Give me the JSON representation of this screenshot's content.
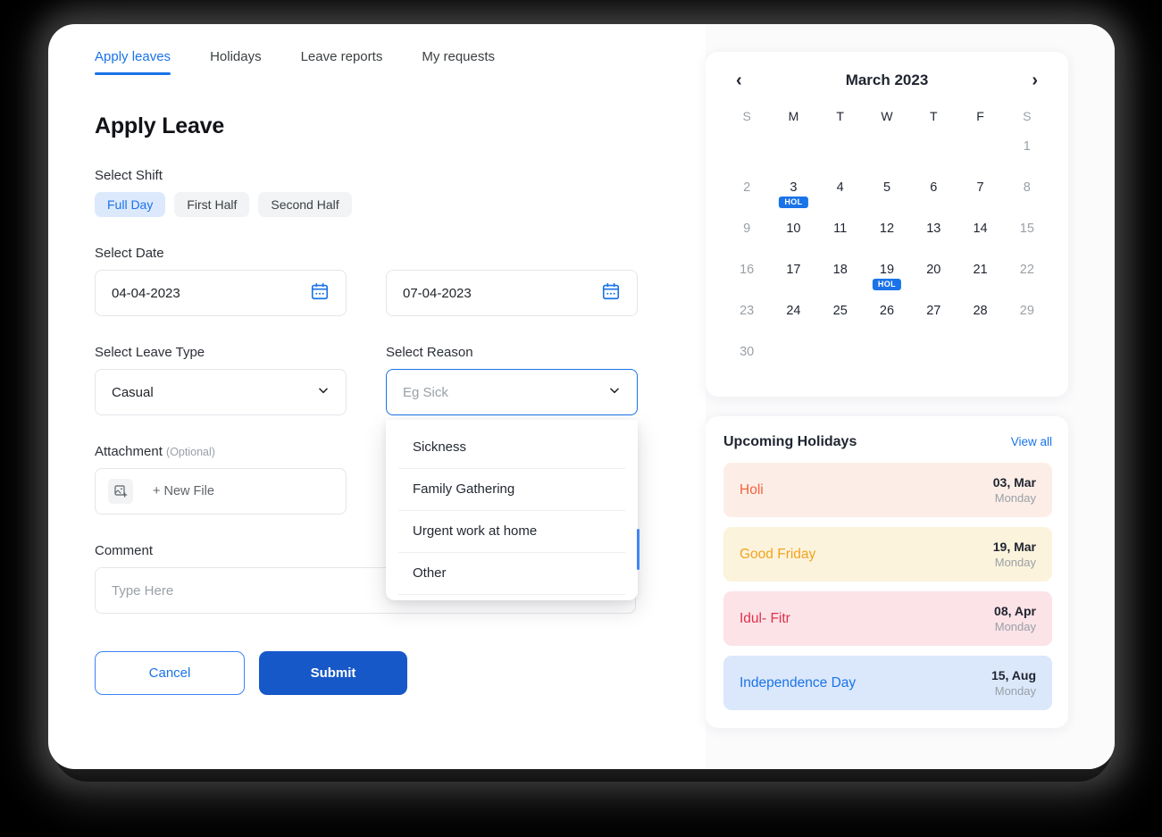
{
  "tabs": [
    {
      "label": "Apply leaves",
      "active": true
    },
    {
      "label": "Holidays",
      "active": false
    },
    {
      "label": "Leave reports",
      "active": false
    },
    {
      "label": "My requests",
      "active": false
    }
  ],
  "page_title": "Apply Leave",
  "shift": {
    "label": "Select Shift",
    "options": [
      "Full Day",
      "First Half",
      "Second Half"
    ],
    "selected": "Full Day"
  },
  "date": {
    "label": "Select Date",
    "from": "04-04-2023",
    "to": "07-04-2023",
    "icon": "calendar-icon"
  },
  "leave_type": {
    "label": "Select Leave Type",
    "value": "Casual",
    "icon": "chevron-down-icon"
  },
  "reason": {
    "label": "Select Reason",
    "placeholder": "Eg Sick",
    "value": "",
    "icon": "chevron-down-icon",
    "open": true,
    "options": [
      "Sickness",
      "Family Gathering",
      "Urgent work at home",
      "Other"
    ]
  },
  "attachment": {
    "label": "Attachment",
    "optional": "(Optional)",
    "button_label": "+ New File",
    "icon": "add-image-icon"
  },
  "comment": {
    "label": "Comment",
    "placeholder": "Type Here",
    "value": ""
  },
  "actions": {
    "cancel": "Cancel",
    "submit": "Submit"
  },
  "calendar": {
    "title": "March 2023",
    "prev_icon": "chevron-left-icon",
    "next_icon": "chevron-right-icon",
    "prev_label": "‹",
    "next_label": "›",
    "day_headers": [
      "S",
      "M",
      "T",
      "W",
      "T",
      "F",
      "S"
    ],
    "weekend_columns": [
      0,
      6
    ],
    "leading_blanks": 3,
    "badge_label": "HOL",
    "days": [
      {
        "n": 1,
        "col": 6,
        "weekend": true,
        "holiday": false
      },
      {
        "n": 2,
        "col": 0,
        "weekend": true,
        "holiday": false
      },
      {
        "n": 3,
        "col": 1,
        "weekend": false,
        "holiday": true
      },
      {
        "n": 4,
        "col": 2,
        "weekend": false,
        "holiday": false
      },
      {
        "n": 5,
        "col": 3,
        "weekend": false,
        "holiday": false
      },
      {
        "n": 6,
        "col": 4,
        "weekend": false,
        "holiday": false
      },
      {
        "n": 7,
        "col": 5,
        "weekend": false,
        "holiday": false
      },
      {
        "n": 8,
        "col": 6,
        "weekend": true,
        "holiday": false
      },
      {
        "n": 9,
        "col": 0,
        "weekend": true,
        "holiday": false
      },
      {
        "n": 10,
        "col": 1,
        "weekend": false,
        "holiday": false
      },
      {
        "n": 11,
        "col": 2,
        "weekend": false,
        "holiday": false
      },
      {
        "n": 12,
        "col": 3,
        "weekend": false,
        "holiday": false
      },
      {
        "n": 13,
        "col": 4,
        "weekend": false,
        "holiday": false
      },
      {
        "n": 14,
        "col": 5,
        "weekend": false,
        "holiday": false
      },
      {
        "n": 15,
        "col": 6,
        "weekend": true,
        "holiday": false
      },
      {
        "n": 16,
        "col": 0,
        "weekend": true,
        "holiday": false
      },
      {
        "n": 17,
        "col": 1,
        "weekend": false,
        "holiday": false
      },
      {
        "n": 18,
        "col": 2,
        "weekend": false,
        "holiday": false
      },
      {
        "n": 19,
        "col": 3,
        "weekend": false,
        "holiday": true
      },
      {
        "n": 20,
        "col": 4,
        "weekend": false,
        "holiday": false
      },
      {
        "n": 21,
        "col": 5,
        "weekend": false,
        "holiday": false
      },
      {
        "n": 22,
        "col": 6,
        "weekend": true,
        "holiday": false
      },
      {
        "n": 23,
        "col": 0,
        "weekend": true,
        "holiday": false
      },
      {
        "n": 24,
        "col": 1,
        "weekend": false,
        "holiday": false
      },
      {
        "n": 25,
        "col": 2,
        "weekend": false,
        "holiday": false
      },
      {
        "n": 26,
        "col": 3,
        "weekend": false,
        "holiday": false
      },
      {
        "n": 27,
        "col": 4,
        "weekend": false,
        "holiday": false
      },
      {
        "n": 28,
        "col": 5,
        "weekend": false,
        "holiday": false
      },
      {
        "n": 29,
        "col": 6,
        "weekend": true,
        "holiday": false
      },
      {
        "n": 30,
        "col": 0,
        "weekend": true,
        "holiday": false
      }
    ]
  },
  "upcoming_holidays": {
    "title": "Upcoming Holidays",
    "view_all": "View all",
    "items": [
      {
        "name": "Holi",
        "date": "03, Mar",
        "day": "Monday",
        "color": "#f4623a",
        "bg": "#fceee7"
      },
      {
        "name": "Good Friday",
        "date": "19, Mar",
        "day": "Monday",
        "color": "#f0a41e",
        "bg": "#fcf3dd"
      },
      {
        "name": "Idul- Fitr",
        "date": "08, Apr",
        "day": "Monday",
        "color": "#e0314b",
        "bg": "#fbe3e8"
      },
      {
        "name": "Independence Day",
        "date": "15, Aug",
        "day": "Monday",
        "color": "#1a73e8",
        "bg": "#dbe8fb"
      }
    ]
  },
  "colors": {
    "accent": "#1a73e8",
    "submit": "#1758c8",
    "chip_selected_bg": "#dce9fd",
    "chip_bg": "#f1f3f4",
    "badge": "#1a73e8",
    "page_bg": "#000000",
    "card_bg": "#ffffff",
    "right_panel_bg": "#fbfbfc"
  }
}
